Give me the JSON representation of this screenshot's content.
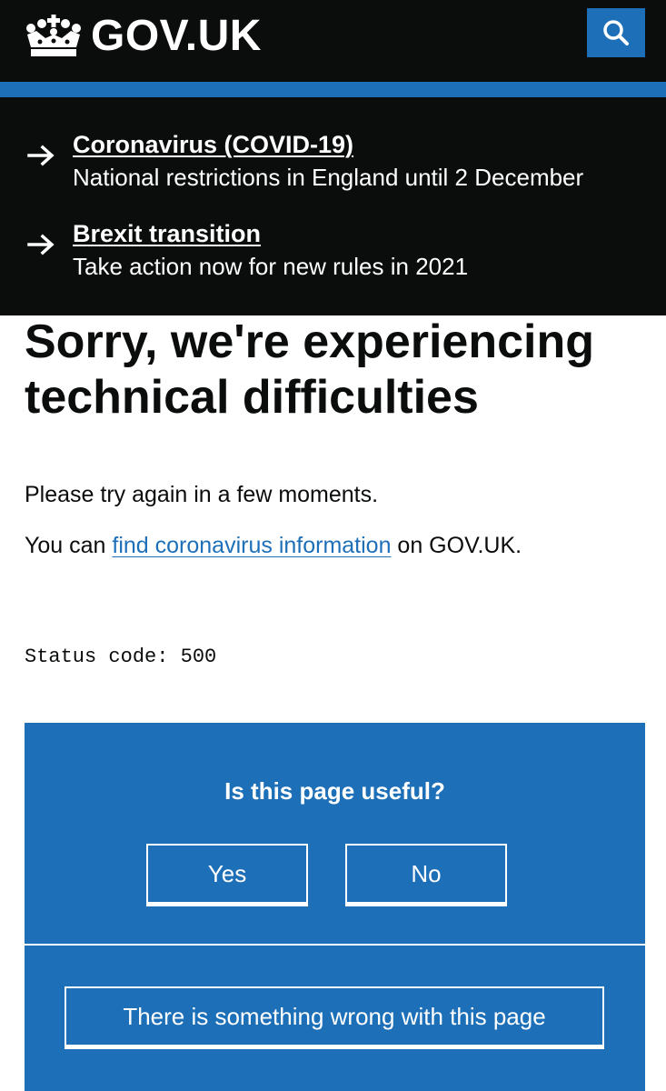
{
  "header": {
    "logo_text": "GOV.UK",
    "search_icon": "search-icon",
    "crown_icon": "crown-icon"
  },
  "notices": [
    {
      "link": "Coronavirus (COVID-19)",
      "description": "National restrictions in England until 2 December",
      "icon": "arrow-right-icon"
    },
    {
      "link": "Brexit transition",
      "description": "Take action now for new rules in 2021",
      "icon": "arrow-right-icon"
    }
  ],
  "main": {
    "title": "Sorry, we're experiencing technical difficulties",
    "paragraph1": "Please try again in a few moments.",
    "paragraph2_prefix": "You can ",
    "paragraph2_link": "find coronavirus information",
    "paragraph2_suffix": " on GOV.UK.",
    "status_code": "Status code: 500"
  },
  "feedback": {
    "question": "Is this page useful?",
    "yes_label": "Yes",
    "no_label": "No",
    "wrong_label": "There is something wrong with this page"
  },
  "colors": {
    "header_bg": "#0b0c0c",
    "brand_blue": "#1d70b8",
    "text": "#0b0c0c",
    "white": "#ffffff"
  }
}
